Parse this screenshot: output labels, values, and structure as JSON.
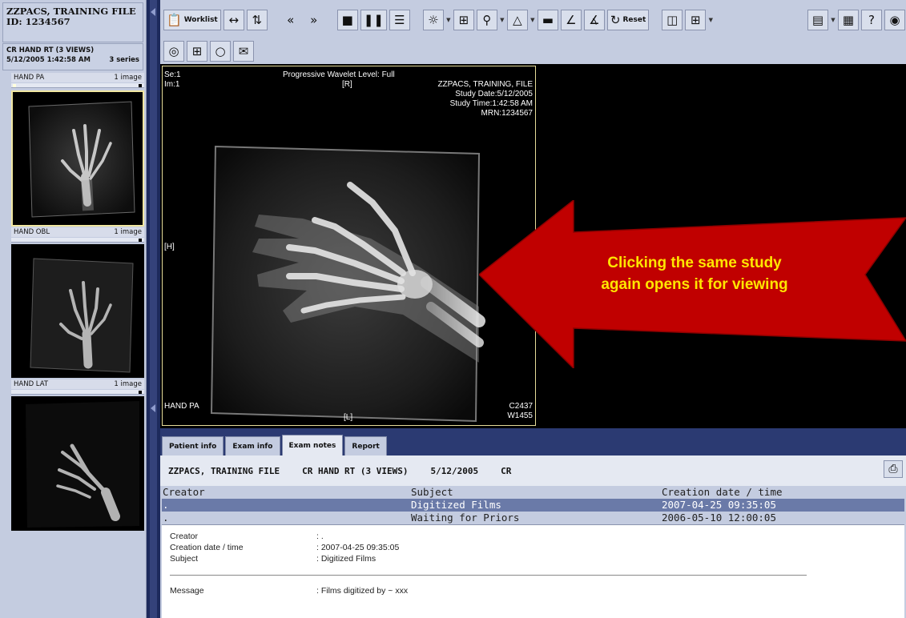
{
  "patient": {
    "name": "ZZPACS, TRAINING FILE",
    "id_line": "ID: 1234567"
  },
  "study": {
    "title": "CR HAND RT (3 VIEWS)",
    "datetime": "5/12/2005 1:42:58 AM",
    "series_count": "3 series"
  },
  "series": [
    {
      "label": "HAND PA",
      "count": "1 image"
    },
    {
      "label": "HAND OBL",
      "count": "1 image"
    },
    {
      "label": "HAND LAT",
      "count": "1 image"
    }
  ],
  "toolbar": {
    "worklist_label": "Worklist",
    "reset_label": "Reset"
  },
  "viewport": {
    "series": "Se:1",
    "image": "Im:1",
    "wavelet": "Progressive Wavelet Level: Full",
    "marker_top": "[R]",
    "marker_left": "[H]",
    "marker_bottom": "[L]",
    "patient_name": "ZZPACS, TRAINING, FILE",
    "study_date": "Study Date:5/12/2005",
    "study_time": "Study Time:1:42:58 AM",
    "mrn": "MRN:1234567",
    "series_label": "HAND PA",
    "center": "C2437",
    "width": "W1455"
  },
  "tabs": [
    "Patient info",
    "Exam info",
    "Exam notes",
    "Report"
  ],
  "active_tab": "Exam notes",
  "summary": {
    "patient": "ZZPACS, TRAINING FILE",
    "study": "CR HAND RT (3 VIEWS)",
    "date": "5/12/2005",
    "modality": "CR"
  },
  "notes_table": {
    "headers": [
      "Creator",
      "Subject",
      "Creation date / time"
    ],
    "rows": [
      [
        ".",
        "Digitized Films",
        "2007-04-25 09:35:05"
      ],
      [
        ".",
        "Waiting for Priors",
        "2006-05-10 12:00:05"
      ]
    ]
  },
  "detail": {
    "creator_label": "Creator",
    "creator_value": ": .",
    "created_label": "Creation date / time",
    "created_value": ": 2007-04-25 09:35:05",
    "subject_label": "Subject",
    "subject_value": ": Digitized Films",
    "message_label": "Message",
    "message_value": ": Films digitized by ~ xxx"
  },
  "callout": {
    "line1": "Clicking the same study",
    "line2": "again opens it for viewing",
    "fill_color": "#c00000",
    "text_color": "#ffe600"
  }
}
